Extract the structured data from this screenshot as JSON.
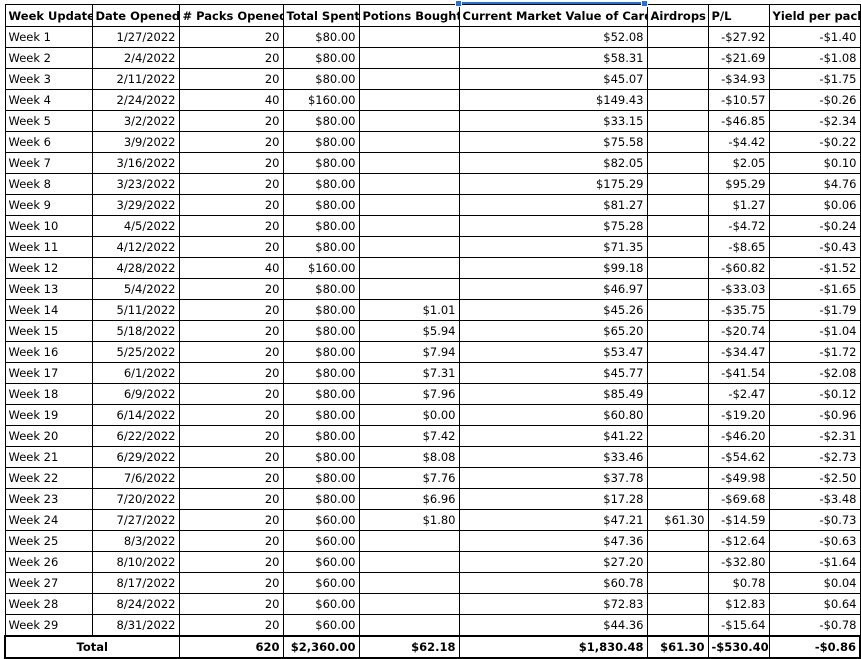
{
  "headers": [
    "Week Update",
    "Date Opened",
    "# Packs Opened",
    "Total Spent",
    "Potions Bought",
    "Current Market Value of Cards",
    "Airdrops",
    "P/L",
    "Yield per pack"
  ],
  "rows": [
    [
      "Week 1",
      "1/27/2022",
      "20",
      "$80.00",
      "",
      "$52.08",
      "",
      "-$27.92",
      "-$1.40"
    ],
    [
      "Week 2",
      "2/4/2022",
      "20",
      "$80.00",
      "",
      "$58.31",
      "",
      "-$21.69",
      "-$1.08"
    ],
    [
      "Week 3",
      "2/11/2022",
      "20",
      "$80.00",
      "",
      "$45.07",
      "",
      "-$34.93",
      "-$1.75"
    ],
    [
      "Week 4",
      "2/24/2022",
      "40",
      "$160.00",
      "",
      "$149.43",
      "",
      "-$10.57",
      "-$0.26"
    ],
    [
      "Week 5",
      "3/2/2022",
      "20",
      "$80.00",
      "",
      "$33.15",
      "",
      "-$46.85",
      "-$2.34"
    ],
    [
      "Week 6",
      "3/9/2022",
      "20",
      "$80.00",
      "",
      "$75.58",
      "",
      "-$4.42",
      "-$0.22"
    ],
    [
      "Week 7",
      "3/16/2022",
      "20",
      "$80.00",
      "",
      "$82.05",
      "",
      "$2.05",
      "$0.10"
    ],
    [
      "Week 8",
      "3/23/2022",
      "20",
      "$80.00",
      "",
      "$175.29",
      "",
      "$95.29",
      "$4.76"
    ],
    [
      "Week 9",
      "3/29/2022",
      "20",
      "$80.00",
      "",
      "$81.27",
      "",
      "$1.27",
      "$0.06"
    ],
    [
      "Week 10",
      "4/5/2022",
      "20",
      "$80.00",
      "",
      "$75.28",
      "",
      "-$4.72",
      "-$0.24"
    ],
    [
      "Week 11",
      "4/12/2022",
      "20",
      "$80.00",
      "",
      "$71.35",
      "",
      "-$8.65",
      "-$0.43"
    ],
    [
      "Week 12",
      "4/28/2022",
      "40",
      "$160.00",
      "",
      "$99.18",
      "",
      "-$60.82",
      "-$1.52"
    ],
    [
      "Week 13",
      "5/4/2022",
      "20",
      "$80.00",
      "",
      "$46.97",
      "",
      "-$33.03",
      "-$1.65"
    ],
    [
      "Week 14",
      "5/11/2022",
      "20",
      "$80.00",
      "$1.01",
      "$45.26",
      "",
      "-$35.75",
      "-$1.79"
    ],
    [
      "Week 15",
      "5/18/2022",
      "20",
      "$80.00",
      "$5.94",
      "$65.20",
      "",
      "-$20.74",
      "-$1.04"
    ],
    [
      "Week 16",
      "5/25/2022",
      "20",
      "$80.00",
      "$7.94",
      "$53.47",
      "",
      "-$34.47",
      "-$1.72"
    ],
    [
      "Week 17",
      "6/1/2022",
      "20",
      "$80.00",
      "$7.31",
      "$45.77",
      "",
      "-$41.54",
      "-$2.08"
    ],
    [
      "Week 18",
      "6/9/2022",
      "20",
      "$80.00",
      "$7.96",
      "$85.49",
      "",
      "-$2.47",
      "-$0.12"
    ],
    [
      "Week 19",
      "6/14/2022",
      "20",
      "$80.00",
      "$0.00",
      "$60.80",
      "",
      "-$19.20",
      "-$0.96"
    ],
    [
      "Week 20",
      "6/22/2022",
      "20",
      "$80.00",
      "$7.42",
      "$41.22",
      "",
      "-$46.20",
      "-$2.31"
    ],
    [
      "Week 21",
      "6/29/2022",
      "20",
      "$80.00",
      "$8.08",
      "$33.46",
      "",
      "-$54.62",
      "-$2.73"
    ],
    [
      "Week 22",
      "7/6/2022",
      "20",
      "$80.00",
      "$7.76",
      "$37.78",
      "",
      "-$49.98",
      "-$2.50"
    ],
    [
      "Week 23",
      "7/20/2022",
      "20",
      "$80.00",
      "$6.96",
      "$17.28",
      "",
      "-$69.68",
      "-$3.48"
    ],
    [
      "Week 24",
      "7/27/2022",
      "20",
      "$60.00",
      "$1.80",
      "$47.21",
      "$61.30",
      "-$14.59",
      "-$0.73"
    ],
    [
      "Week 25",
      "8/3/2022",
      "20",
      "$60.00",
      "",
      "$47.36",
      "",
      "-$12.64",
      "-$0.63"
    ],
    [
      "Week 26",
      "8/10/2022",
      "20",
      "$60.00",
      "",
      "$27.20",
      "",
      "-$32.80",
      "-$1.64"
    ],
    [
      "Week 27",
      "8/17/2022",
      "20",
      "$60.00",
      "",
      "$60.78",
      "",
      "$0.78",
      "$0.04"
    ],
    [
      "Week 28",
      "8/24/2022",
      "20",
      "$60.00",
      "",
      "$72.83",
      "",
      "$12.83",
      "$0.64"
    ],
    [
      "Week 29",
      "8/31/2022",
      "20",
      "$60.00",
      "",
      "$44.36",
      "",
      "-$15.64",
      "-$0.78"
    ]
  ],
  "total": [
    "Total",
    "",
    "620",
    "$2,360.00",
    "$62.18",
    "$1,830.48",
    "$61.30",
    "-$530.40",
    "-$0.86"
  ],
  "selection_color": "#1a73e8"
}
